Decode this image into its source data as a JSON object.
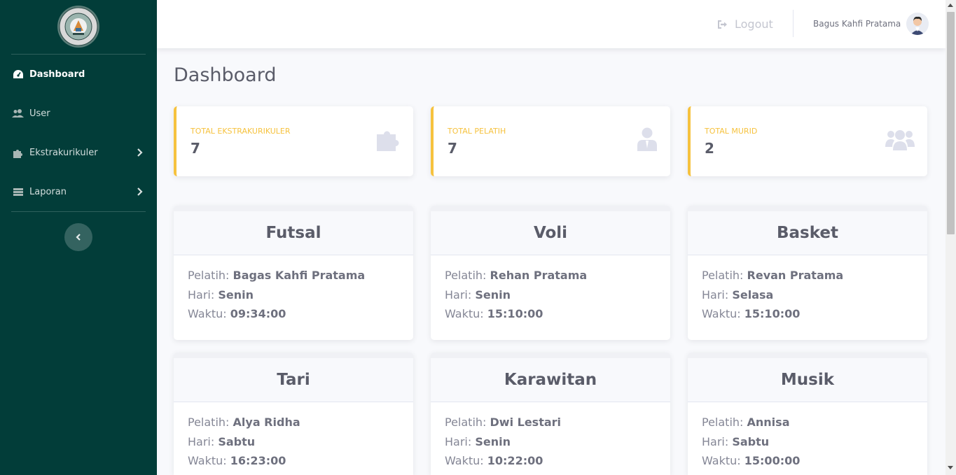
{
  "sidebar": {
    "items": [
      {
        "label": "Dashboard",
        "icon": "tachometer-icon",
        "active": true
      },
      {
        "label": "User",
        "icon": "users-cog-icon"
      },
      {
        "label": "Ekstrakurikuler",
        "icon": "puzzle-icon",
        "has_submenu": true
      },
      {
        "label": "Laporan",
        "icon": "report-icon",
        "has_submenu": true
      }
    ]
  },
  "topbar": {
    "logout_label": "Logout",
    "user_name": "Bagus Kahfi Pratama"
  },
  "page": {
    "title": "Dashboard"
  },
  "stats": [
    {
      "label": "TOTAL EKSTRAKURIKULER",
      "value": "7",
      "icon": "puzzle-icon"
    },
    {
      "label": "TOTAL PELATIH",
      "value": "7",
      "icon": "user-tie-icon"
    },
    {
      "label": "TOTAL MURID",
      "value": "2",
      "icon": "users-icon"
    }
  ],
  "field_labels": {
    "pelatih": "Pelatih:",
    "hari": "Hari:",
    "waktu": "Waktu:"
  },
  "cards": [
    {
      "title": "Futsal",
      "pelatih": "Bagas Kahfi Pratama",
      "hari": "Senin",
      "waktu": "09:34:00"
    },
    {
      "title": "Voli",
      "pelatih": "Rehan Pratama",
      "hari": "Senin",
      "waktu": "15:10:00"
    },
    {
      "title": "Basket",
      "pelatih": "Revan Pratama",
      "hari": "Selasa",
      "waktu": "15:10:00"
    },
    {
      "title": "Tari",
      "pelatih": "Alya Ridha",
      "hari": "Sabtu",
      "waktu": "16:23:00"
    },
    {
      "title": "Karawitan",
      "pelatih": "Dwi Lestari",
      "hari": "Senin",
      "waktu": "10:22:00"
    },
    {
      "title": "Musik",
      "pelatih": "Annisa",
      "hari": "Sabtu",
      "waktu": "15:00:00"
    }
  ],
  "colors": {
    "sidebar_bg": "#023d39",
    "accent_warning": "#f6c23e",
    "text_dark": "#5a5c69",
    "text_muted": "#858796"
  }
}
